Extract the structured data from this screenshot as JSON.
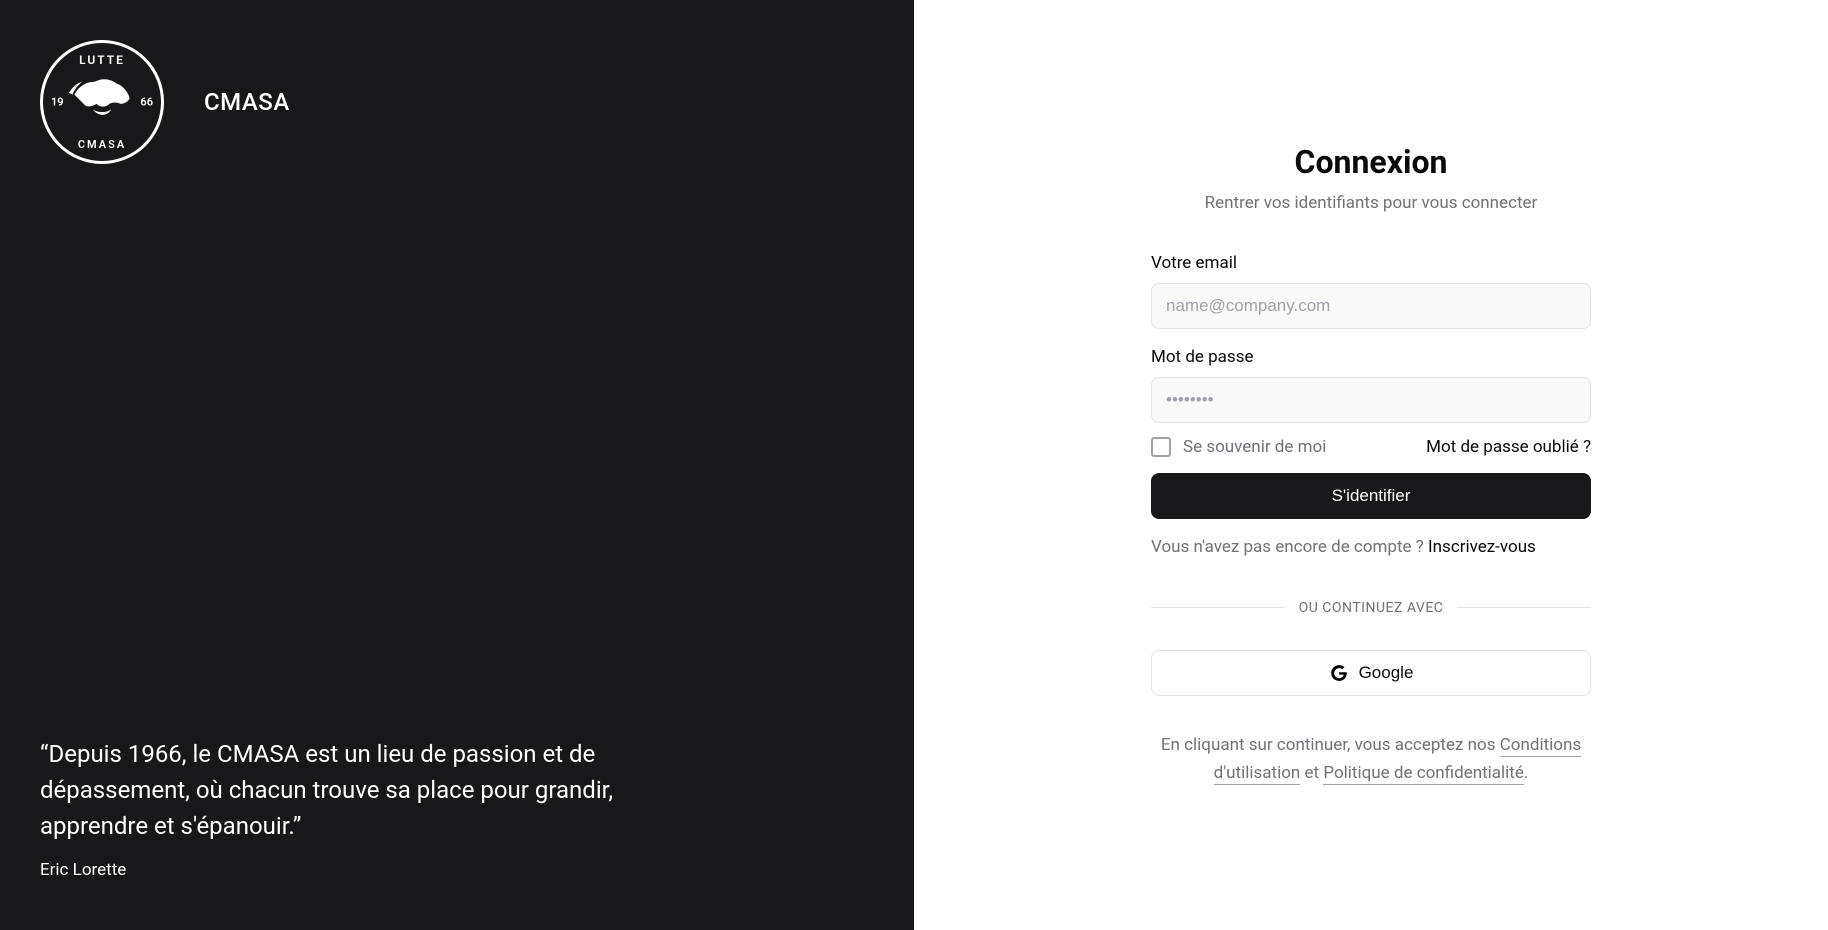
{
  "left": {
    "logo": {
      "top_text": "LUTTE",
      "bottom_text": "CMASA",
      "year_left": "19",
      "year_right": "66"
    },
    "brand": "CMASA",
    "quote": "“Depuis 1966, le CMASA est un lieu de passion et de dépassement, où chacun trouve sa place pour grandir, apprendre et s'épanouir.”",
    "author": "Eric Lorette"
  },
  "form": {
    "title": "Connexion",
    "subtitle": "Rentrer vos identifiants pour vous connecter",
    "email_label": "Votre email",
    "email_placeholder": "name@company.com",
    "password_label": "Mot de passe",
    "password_placeholder": "••••••••",
    "remember_label": "Se souvenir de moi",
    "forgot_label": "Mot de passe oublié ?",
    "submit_label": "S'identifier",
    "signup_prompt": "Vous n'avez pas encore de compte ? ",
    "signup_link": "Inscrivez-vous",
    "divider": "OU CONTINUEZ AVEC",
    "google_label": "Google",
    "legal_intro": "En cliquant sur continuer, vous acceptez nos ",
    "legal_terms": "Conditions d'utilisation",
    "legal_and": " et ",
    "legal_privacy": "Politique de confidentialité",
    "legal_period": "."
  }
}
